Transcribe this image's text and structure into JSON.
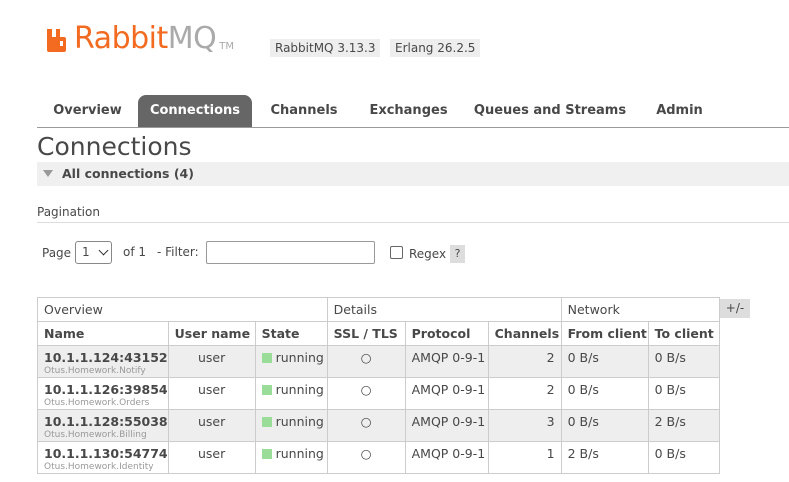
{
  "header": {
    "logo_rabbit": "Rabbit",
    "logo_mq": "MQ",
    "logo_tm": "TM",
    "rabbitmq_version": "RabbitMQ 3.13.3",
    "erlang_version": "Erlang 26.2.5"
  },
  "tabs": [
    {
      "label": "Overview",
      "active": false
    },
    {
      "label": "Connections",
      "active": true
    },
    {
      "label": "Channels",
      "active": false
    },
    {
      "label": "Exchanges",
      "active": false
    },
    {
      "label": "Queues and Streams",
      "active": false
    },
    {
      "label": "Admin",
      "active": false
    }
  ],
  "page": {
    "title": "Connections",
    "section_label": "All connections (4)",
    "pagination_label": "Pagination"
  },
  "pagination": {
    "page_label": "Page",
    "page_value": "1",
    "of_label": "of 1",
    "filter_label": "- Filter:",
    "filter_value": "",
    "regex_label": "Regex",
    "regex_checked": false,
    "help_label": "?"
  },
  "table": {
    "groups": [
      "Overview",
      "Details",
      "Network"
    ],
    "columns": [
      "Name",
      "User name",
      "State",
      "SSL / TLS",
      "Protocol",
      "Channels",
      "From client",
      "To client"
    ],
    "toggle_label": "+/-",
    "rows": [
      {
        "name": "10.1.1.124:43152",
        "client": "Otus.Homework.Notify",
        "user": "user",
        "state": "running",
        "ssl": "○",
        "protocol": "AMQP 0-9-1",
        "channels": "2",
        "from_client": "0 B/s",
        "to_client": "0 B/s"
      },
      {
        "name": "10.1.1.126:39854",
        "client": "Otus.Homework.Orders",
        "user": "user",
        "state": "running",
        "ssl": "○",
        "protocol": "AMQP 0-9-1",
        "channels": "2",
        "from_client": "0 B/s",
        "to_client": "0 B/s"
      },
      {
        "name": "10.1.1.128:55038",
        "client": "Otus.Homework.Billing",
        "user": "user",
        "state": "running",
        "ssl": "○",
        "protocol": "AMQP 0-9-1",
        "channels": "3",
        "from_client": "0 B/s",
        "to_client": "2 B/s"
      },
      {
        "name": "10.1.1.130:54774",
        "client": "Otus.Homework.Identity",
        "user": "user",
        "state": "running",
        "ssl": "○",
        "protocol": "AMQP 0-9-1",
        "channels": "1",
        "from_client": "2 B/s",
        "to_client": "0 B/s"
      }
    ]
  },
  "colors": {
    "brand_orange": "#f36b21",
    "running_green": "#99dd99",
    "active_tab": "#666666"
  }
}
